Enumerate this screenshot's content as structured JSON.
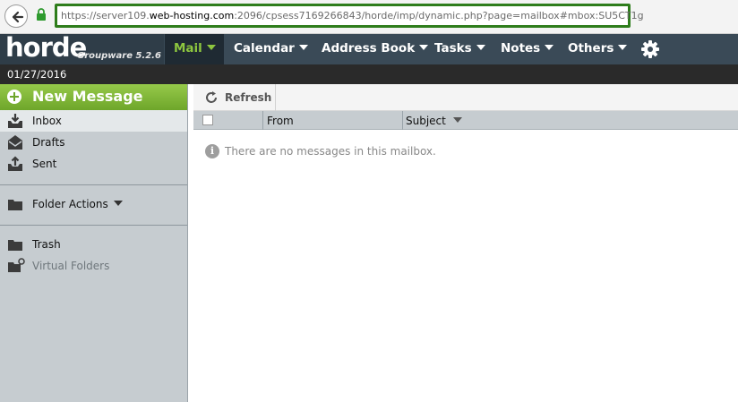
{
  "browser": {
    "url_prefix": "https://server109.",
    "url_domain": "web-hosting.com",
    "url_rest": ":2096/cpsess7169266843/horde/imp/dynamic.php?page=mailbox#mbox:SU5CT1g"
  },
  "header": {
    "logo": "horde",
    "product": "Groupware 5.2.6",
    "nav": [
      {
        "label": "Mail",
        "active": true
      },
      {
        "label": "Calendar"
      },
      {
        "label": "Address Book"
      },
      {
        "label": "Tasks"
      },
      {
        "label": "Notes"
      },
      {
        "label": "Others"
      }
    ],
    "settings_icon": "gear-icon"
  },
  "date": "01/27/2016",
  "sidebar": {
    "new_message": "New Message",
    "folders": [
      {
        "label": "Inbox",
        "icon": "inbox-icon",
        "selected": true
      },
      {
        "label": "Drafts",
        "icon": "drafts-icon"
      },
      {
        "label": "Sent",
        "icon": "sent-icon"
      }
    ],
    "folder_actions": "Folder Actions",
    "trash": "Trash",
    "virtual_folders": "Virtual Folders"
  },
  "main": {
    "refresh": "Refresh",
    "columns": {
      "from": "From",
      "subject": "Subject"
    },
    "empty_message": "There are no messages in this mailbox."
  },
  "colors": {
    "accent_green": "#8dc63f",
    "header_bg": "#3a4a57",
    "url_highlight_border": "#2e7d1b"
  }
}
